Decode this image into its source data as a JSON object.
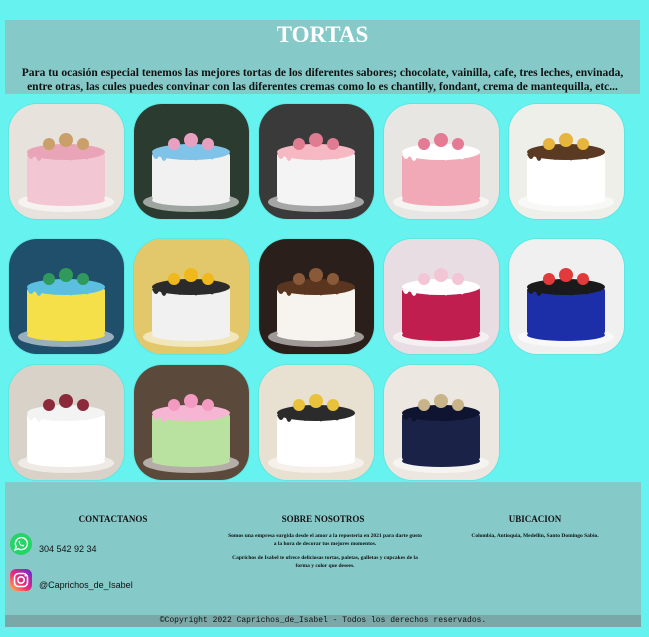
{
  "header": {
    "title": "TORTAS",
    "intro": "Para tu ocasión especial tenemos las mejores tortas de los diferentes sabores; chocolate, vainilla, cafe, tres leches, envinada, entre otras, las cules puedes convinar con las diferentes cremas como lo es chantilly, fondant, crema de mantequilla, etc..."
  },
  "gallery": [
    {
      "name": "cake-photo-1",
      "bg": "#e8e2dc",
      "body": "#f3c6d4",
      "top": "#e9a4b8",
      "accent": "#c9a06a"
    },
    {
      "name": "cake-photo-2",
      "bg": "#2c3b30",
      "body": "#f1f1f1",
      "top": "#7fc3e8",
      "accent": "#e8a0c0"
    },
    {
      "name": "cake-photo-3",
      "bg": "#3a3a3a",
      "body": "#f4f4f4",
      "top": "#f6b9c4",
      "accent": "#e07c92"
    },
    {
      "name": "cake-photo-4",
      "bg": "#e8e6e2",
      "body": "#f2a9b7",
      "top": "#ffffff",
      "accent": "#e57a95"
    },
    {
      "name": "cake-photo-5",
      "bg": "#efefea",
      "body": "#ffffff",
      "top": "#5a3a22",
      "accent": "#e7b53d"
    },
    {
      "name": "cake-photo-6",
      "bg": "#1f4f6b",
      "body": "#f6e04a",
      "top": "#5bbfe0",
      "accent": "#2f9a5b"
    },
    {
      "name": "cake-photo-7",
      "bg": "#e3c86b",
      "body": "#f1f1f1",
      "top": "#2b2b2b",
      "accent": "#f0b81b"
    },
    {
      "name": "cake-photo-8",
      "bg": "#2a1f1b",
      "body": "#f7f3ee",
      "top": "#5a3520",
      "accent": "#8a5a38"
    },
    {
      "name": "cake-photo-9",
      "bg": "#e7dde2",
      "body": "#c01e4f",
      "top": "#ffffff",
      "accent": "#f2c6d5"
    },
    {
      "name": "cake-photo-10",
      "bg": "#f0f0f0",
      "body": "#1c2fa8",
      "top": "#1a1a1a",
      "accent": "#e13a3a"
    },
    {
      "name": "cake-photo-11",
      "bg": "#d9d2c8",
      "body": "#ffffff",
      "top": "#f3f3f3",
      "accent": "#8a2a3a"
    },
    {
      "name": "cake-photo-12",
      "bg": "#5b4a3c",
      "body": "#b9e1a0",
      "top": "#f6b6d3",
      "accent": "#f39ac1"
    },
    {
      "name": "cake-photo-13",
      "bg": "#e8e0d0",
      "body": "#ffffff",
      "top": "#2b2b2b",
      "accent": "#e7c23a"
    },
    {
      "name": "cake-photo-14",
      "bg": "#ece7e0",
      "body": "#1a2347",
      "top": "#0f1530",
      "accent": "#c9b48a"
    }
  ],
  "footer": {
    "contact": {
      "title": "CONTACTANOS",
      "phone": "304 542 92 34",
      "instagram": "@Caprichos_de_Isabel"
    },
    "about": {
      "title": "SOBRE NOSOTROS",
      "p1": "Somos una empresa surgida desde el amor a la reposteria en 2021 para darte gusto a la hora de decorar tus mejores momentos.",
      "p2": "Caprichos de Isabel te ofrece deliciosas tortas, paletas, galletas y cupcakes de la forma y color que desees."
    },
    "location": {
      "title": "UBICACION",
      "text": "Colombia, Antioquia, Medellin, Santo Domingo Sabio."
    }
  },
  "copyright": "©Copyright 2022 Caprichos_de_Isabel - Todos los derechos reservados.",
  "colors": {
    "page_bg": "#66f2ee",
    "panel": "#86c9c9",
    "whatsapp": "#25d366",
    "instagram": "#d6249f"
  }
}
